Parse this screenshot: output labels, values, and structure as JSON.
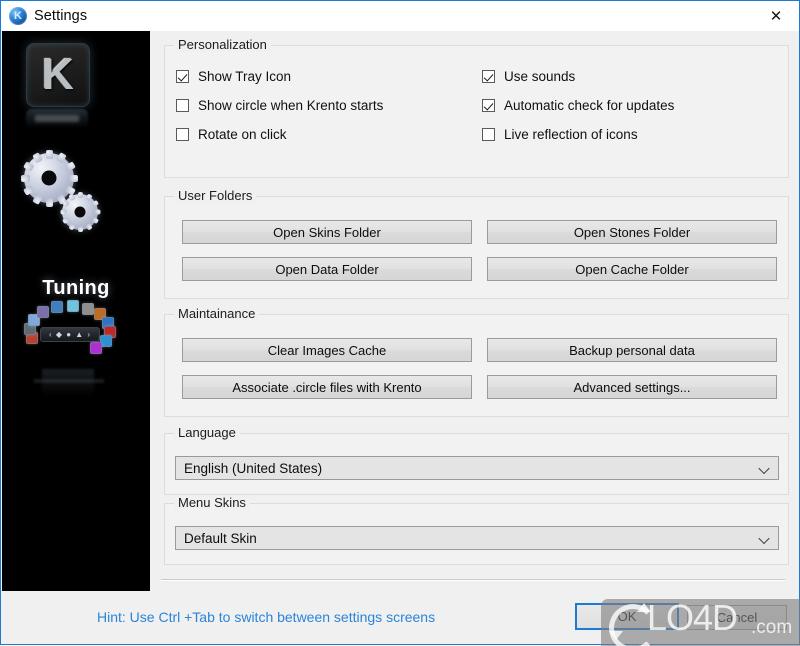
{
  "window": {
    "title": "Settings",
    "icon": "krento-app-icon",
    "close_label": "✕",
    "accent_color": "#1a7ad4"
  },
  "sidebar": {
    "logo_letter": "K",
    "caption": "Tuning",
    "widget_label": "‹ ◆ ● ▲ ›"
  },
  "groups": {
    "personalization": {
      "legend": "Personalization",
      "checkboxes_left": [
        {
          "label": "Show Tray Icon",
          "checked": true
        },
        {
          "label": "Show circle when Krento starts",
          "checked": false
        },
        {
          "label": "Rotate on click",
          "checked": false
        }
      ],
      "checkboxes_right": [
        {
          "label": "Use sounds",
          "checked": true
        },
        {
          "label": "Automatic check for updates",
          "checked": true
        },
        {
          "label": "Live reflection of icons",
          "checked": false
        }
      ]
    },
    "user_folders": {
      "legend": "User Folders",
      "buttons": [
        "Open Skins Folder",
        "Open Stones Folder",
        "Open Data Folder",
        "Open Cache Folder"
      ]
    },
    "maintainance": {
      "legend": "Maintainance",
      "buttons": [
        "Clear Images Cache",
        "Backup personal data",
        "Associate .circle files with Krento",
        "Advanced settings..."
      ]
    },
    "language": {
      "legend": "Language",
      "selected": "English (United States)"
    },
    "menu_skins": {
      "legend": "Menu Skins",
      "selected": "Default Skin"
    }
  },
  "footer": {
    "hint": "Hint: Use Ctrl +Tab to switch between settings screens",
    "hint_color": "#2a85d8",
    "ok_label": "OK",
    "cancel_label": "Cancel"
  },
  "watermark": {
    "text": "LO4D",
    "suffix": ".com"
  }
}
